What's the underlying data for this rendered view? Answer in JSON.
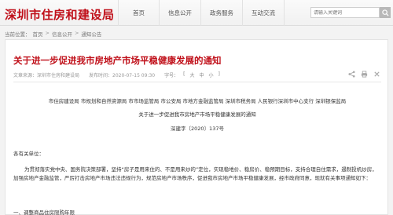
{
  "header": {
    "site_title": "深圳市住房和建设局",
    "nav": [
      "首页",
      "信息公开",
      "政务服务",
      "互动交流"
    ],
    "search_placeholder": "请输入关键词"
  },
  "breadcrumb": [
    "当前位置：",
    "首页",
    "信息公开",
    "通知公告"
  ],
  "article": {
    "title": "关于进一步促进我市房地产市场平稳健康发展的通知",
    "source": "文章来源：深圳市住房和建设局",
    "published": "发布时间：2020-07-15 09:30",
    "font_label": "字号：",
    "font_sizes": [
      "大",
      "中",
      "小"
    ],
    "issuers": "市住房建设局 市规划和自然资源局 市市场监管局 市公安局 市地方金融监管局 深圳市税务局 人民银行深圳市中心支行 深圳银保监局",
    "subtitle": "关于进一步促进我市房地产市场平稳健康发展的通知",
    "doc_no": "深建字〔2020〕137号",
    "salutation": "各有关单位：",
    "paragraph": "为贯彻落实党中央、国务院决策部署，坚持“房子是用来住的、不是用来炒的”定位，实现稳地价、稳房价、稳预期目标，支持合理自住需求，遏制投机炒房，加强房地产金融监管，严厉打击房地产市场违法违规行为，规范房地产市场秩序，促进我市房地产市场平稳健康发展，经市政府同意，现就有关事项通知如下：",
    "item1": "一、调整商品住房限购年限"
  }
}
